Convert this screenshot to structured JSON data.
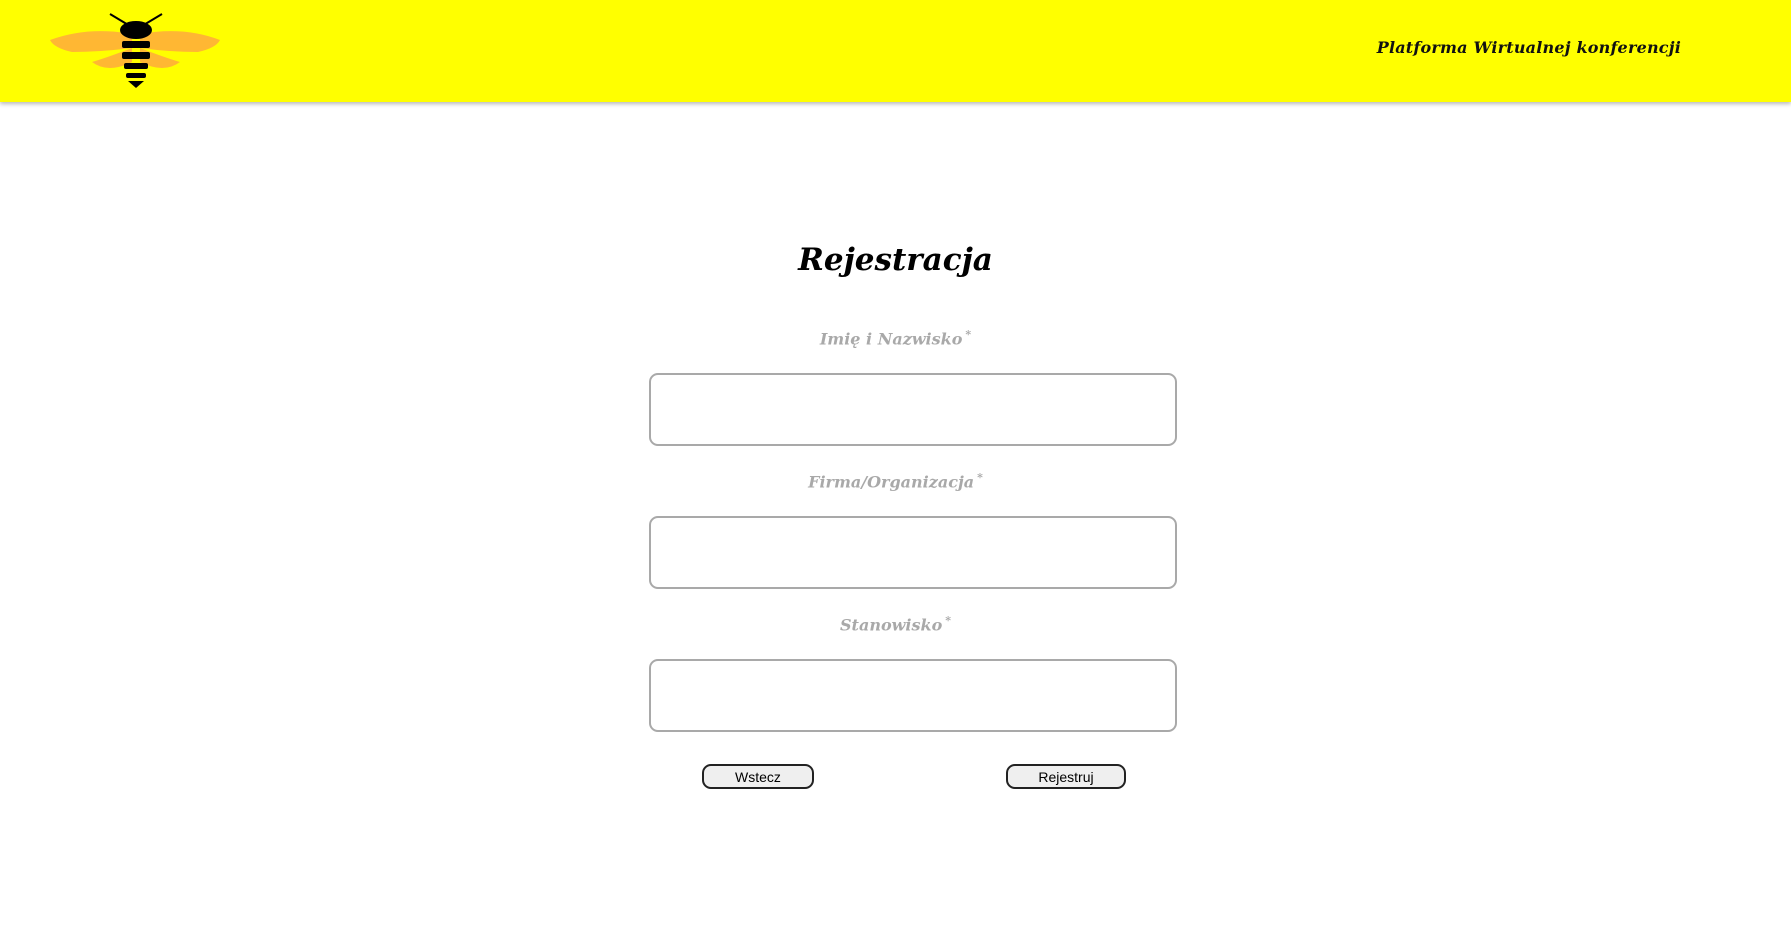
{
  "header": {
    "logo_icon": "bee-icon",
    "app_title": "Platforma Wirtualnej konferencji",
    "background_color": "#ffff00"
  },
  "form": {
    "title": "Rejestracja",
    "required_marker": "*",
    "fields": [
      {
        "label": "Imię i Nazwisko",
        "value": "",
        "placeholder": ""
      },
      {
        "label": "Firma/Organizacja",
        "value": "",
        "placeholder": ""
      },
      {
        "label": "Stanowisko",
        "value": "",
        "placeholder": ""
      }
    ],
    "buttons": {
      "back_label": "Wstecz",
      "register_label": "Rejestruj"
    }
  },
  "colors": {
    "label_gray": "#a9a9a9",
    "wing_orange": "#ffb733",
    "bee_black": "#000000"
  }
}
